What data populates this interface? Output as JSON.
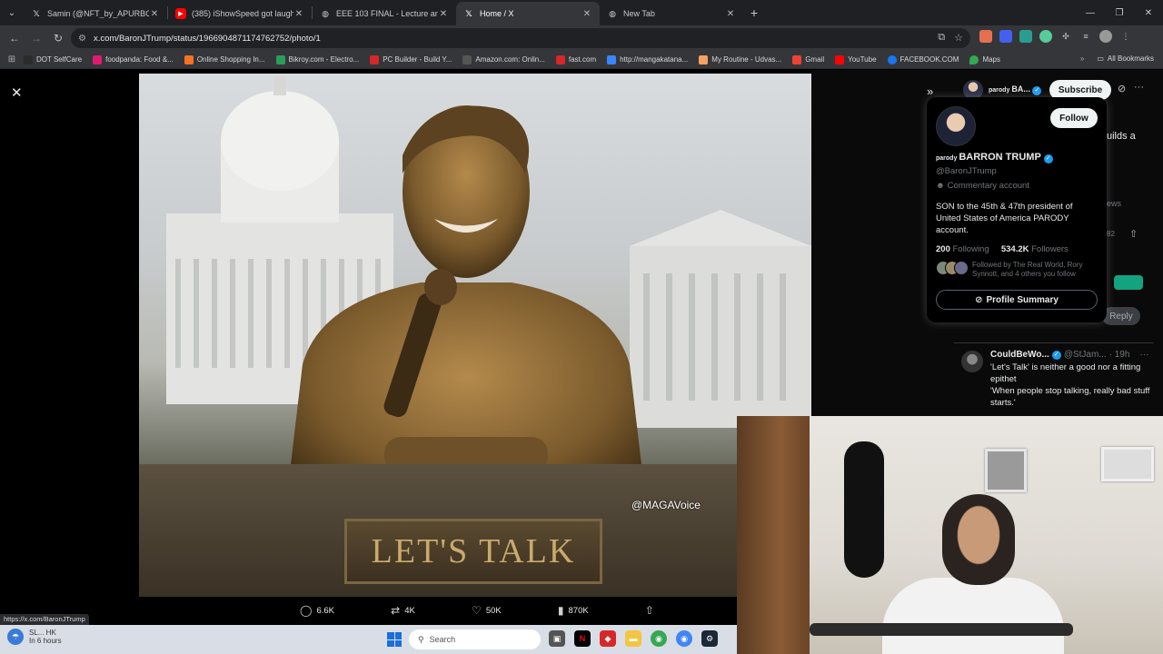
{
  "browser": {
    "tabs": [
      {
        "title": "Samin (@NFT_by_APURBO) / X",
        "icon": "x-icon",
        "active": false
      },
      {
        "title": "(385) iShowSpeed got laughed",
        "icon": "youtube-icon",
        "active": false
      },
      {
        "title": "EEE 103 FINAL - Lecture analys",
        "icon": "globe-icon",
        "active": false
      },
      {
        "title": "Home / X",
        "icon": "x-icon",
        "active": true
      },
      {
        "title": "New Tab",
        "icon": "globe-icon",
        "active": false
      }
    ],
    "url": "x.com/BaronJTrump/status/1966904871174762752/photo/1",
    "bookmarks": [
      {
        "label": "DOT SelfCare",
        "color": "#2b2b2b"
      },
      {
        "label": "foodpanda: Food &...",
        "color": "#e21b70"
      },
      {
        "label": "Online Shopping In...",
        "color": "#f57224"
      },
      {
        "label": "Bikroy.com - Electro...",
        "color": "#2a9d5b"
      },
      {
        "label": "PC Builder - Build Y...",
        "color": "#d62828"
      },
      {
        "label": "Amazon.com: Onlin...",
        "color": "#555555"
      },
      {
        "label": "fast.com",
        "color": "#d62828"
      },
      {
        "label": "http://mangakatana...",
        "color": "#3a86ff"
      },
      {
        "label": "My Routine - Udvas...",
        "color": "#f4a261"
      },
      {
        "label": "Gmail",
        "color": "#ea4335"
      },
      {
        "label": "YouTube",
        "color": "#ff0000"
      },
      {
        "label": "FACEBOOK.COM",
        "color": "#1877f2"
      },
      {
        "label": "Maps",
        "color": "#34a853"
      }
    ],
    "all_bookmarks": "All Bookmarks",
    "status_url": "https://x.com/BaronJTrump"
  },
  "photo": {
    "watermark": "@MAGAVoice",
    "plaque_text": "LET'S TALK"
  },
  "tweet_actions": {
    "replies": "6.6K",
    "reposts": "4K",
    "likes": "50K",
    "views": "870K"
  },
  "right_panel": {
    "header_name": "BA...",
    "header_parody": "parody",
    "subscribe": "Subscribe",
    "fragments": {
      "builds": "uilds a",
      "views": "ews",
      "count": "82",
      "reply": "Reply"
    }
  },
  "hover_card": {
    "follow": "Follow",
    "parody": "parody",
    "name": "BARRON TRUMP",
    "handle": "@BaronJTrump",
    "commentary": "Commentary account",
    "bio": "SON to the 45th & 47th president of United States of America PARODY account.",
    "following_count": "200",
    "following_label": "Following",
    "followers_count": "534.2K",
    "followers_label": "Followers",
    "followed_by": "Followed by The Real World, Rory Synnott, and 4 others you follow",
    "profile_summary": "Profile Summary"
  },
  "reply_tweet": {
    "name": "CouldBeWo...",
    "handle": "@StJam...",
    "time": "· 19h",
    "line1": "'Let's Talk' is neither a good nor a fitting epithet",
    "line2": "'When people stop talking, really bad stuff starts.'"
  },
  "taskbar": {
    "weather_temp": "SL... HK",
    "weather_sub": "In 6 hours",
    "search_placeholder": "Search"
  }
}
